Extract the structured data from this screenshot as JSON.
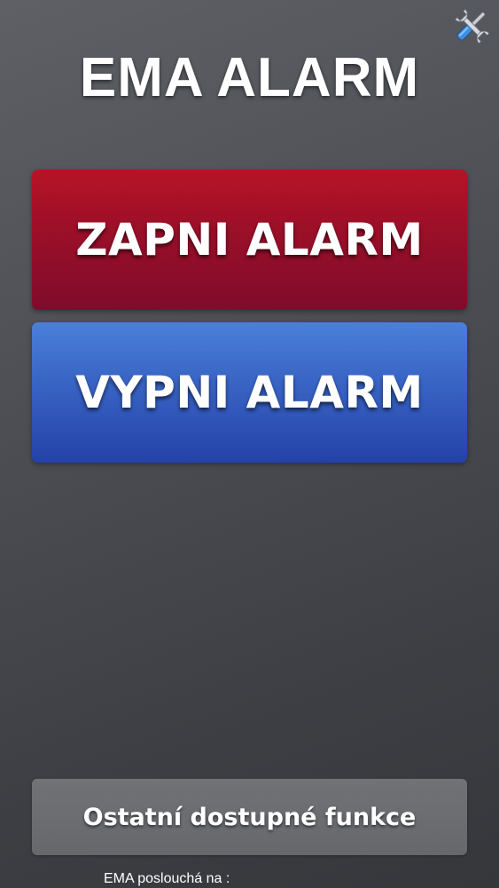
{
  "header": {
    "title": "EMA ALARM",
    "settings_icon": "tools-icon"
  },
  "actions": {
    "alarm_on_label": "ZAPNI ALARM",
    "alarm_off_label": "VYPNI ALARM"
  },
  "footer": {
    "functions_label": "Ostatní dostupné funkce",
    "listening_label": "EMA poslouchá na :"
  },
  "colors": {
    "background": "#4a4c52",
    "alarm_on": "#a01028",
    "alarm_off": "#3a66c6",
    "functions_button": "#6b6d71"
  }
}
